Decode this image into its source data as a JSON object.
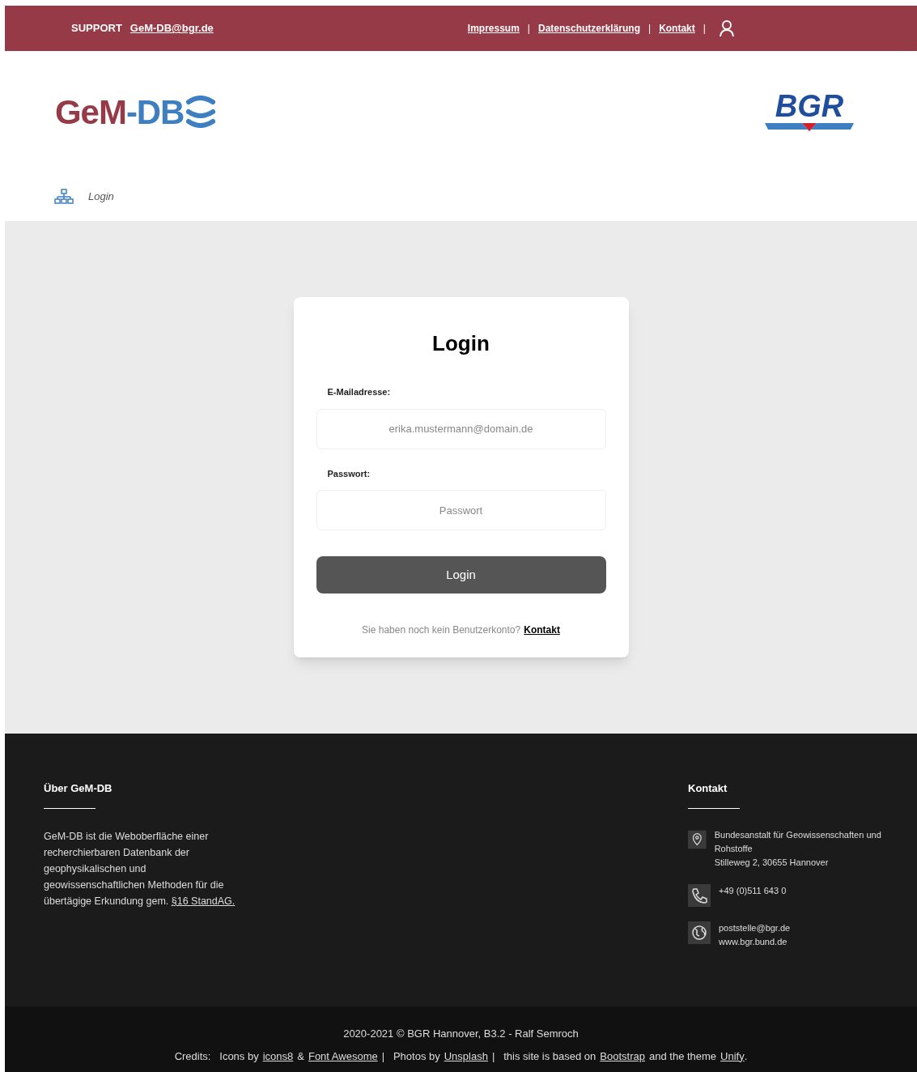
{
  "top_bar": {
    "support_label": "SUPPORT",
    "support_email": "GeM-DB@bgr.de",
    "links": [
      "Impressum",
      "Datenschutzerklärung",
      "Kontakt"
    ],
    "separator": "|"
  },
  "header": {
    "logo": {
      "part_1": "GeM",
      "part_2": "-DB"
    },
    "partner_logo": "BGR"
  },
  "breadcrumb": {
    "current": "Login"
  },
  "login_card": {
    "title": "Login",
    "fields": [
      {
        "label": "E-Mailadresse:",
        "placeholder": "erika.mustermann@domain.de"
      },
      {
        "label": "Passwort:",
        "placeholder": "Passwort"
      }
    ],
    "submit": "Login",
    "note": "Sie haben noch kein Benutzerkonto?",
    "note_link": "Kontakt"
  },
  "footer": {
    "about": {
      "title": "Über GeM-DB",
      "text": "GeM-DB ist die Weboberfläche einer recherchierbaren Datenbank der geophysikalischen und geowissenschaftlichen Methoden für die übertägige Erkundung gem.",
      "link": "§16 StandAG."
    },
    "contact": {
      "title": "Kontakt",
      "items": [
        {
          "kind": "address",
          "lines": [
            "Bundesanstalt für Geowissenschaften und Rohstoffe",
            "Stilleweg 2, 30655 Hannover"
          ]
        },
        {
          "kind": "phone",
          "lines": [
            "+49 (0)511 643 0"
          ]
        },
        {
          "kind": "web",
          "lines": [
            "poststelle@bgr.de",
            "www.bgr.bund.de"
          ]
        }
      ]
    }
  },
  "bottom_bar": {
    "copyright": "2020-2021 © BGR Hannover, B3.2 - Ralf Semroch",
    "credits": [
      {
        "kind": "text",
        "text": "Credits:   Icons by"
      },
      {
        "kind": "link",
        "text": "icons8"
      },
      {
        "kind": "text",
        "text": "&"
      },
      {
        "kind": "link",
        "text": "Font Awesome"
      },
      {
        "kind": "text",
        "text": "|   Photos by"
      },
      {
        "kind": "link",
        "text": "Unsplash"
      },
      {
        "kind": "text",
        "text": "|   this site is based on"
      },
      {
        "kind": "link",
        "text": "Bootstrap"
      },
      {
        "kind": "text",
        "text": "and the theme"
      },
      {
        "kind": "link",
        "text": "Unify"
      },
      {
        "kind": "text",
        "text": "."
      }
    ]
  }
}
